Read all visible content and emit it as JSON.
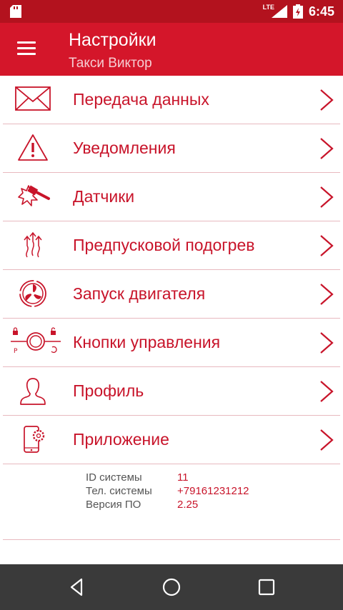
{
  "status_bar": {
    "network": "LTE",
    "time": "6:45"
  },
  "header": {
    "title": "Настройки",
    "subtitle": "Такси Виктор"
  },
  "menu": [
    {
      "label": "Передача данных",
      "icon": "envelope-icon"
    },
    {
      "label": "Уведомления",
      "icon": "warning-icon"
    },
    {
      "label": "Датчики",
      "icon": "hammer-shock-icon"
    },
    {
      "label": "Предпусковой подогрев",
      "icon": "heat-arrows-icon"
    },
    {
      "label": "Запуск двигателя",
      "icon": "engine-fan-icon"
    },
    {
      "label": "Кнопки управления",
      "icon": "control-buttons-icon"
    },
    {
      "label": "Профиль",
      "icon": "profile-icon"
    },
    {
      "label": "Приложение",
      "icon": "phone-gear-icon"
    }
  ],
  "system_info": [
    {
      "key": "ID системы",
      "value": "11"
    },
    {
      "key": "Тел. системы",
      "value": "+79161231212"
    },
    {
      "key": "Версия ПО",
      "value": "2.25"
    }
  ],
  "colors": {
    "accent": "#d4162a",
    "statusbar": "#b3121e",
    "navbar": "#3a3a3a"
  }
}
